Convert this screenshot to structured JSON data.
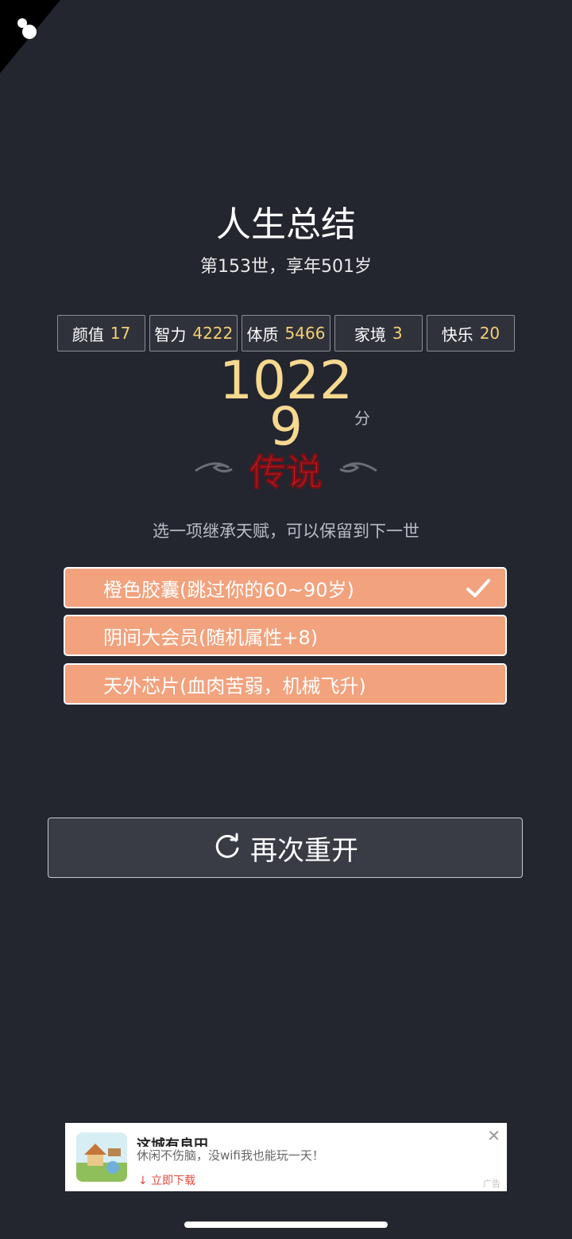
{
  "header": {
    "title": "人生总结",
    "subtitle": "第153世，享年501岁"
  },
  "stats": [
    {
      "label": "颜值",
      "value": "17"
    },
    {
      "label": "智力",
      "value": "4222"
    },
    {
      "label": "体质",
      "value": "5466"
    },
    {
      "label": "家境",
      "value": "3"
    },
    {
      "label": "快乐",
      "value": "20"
    }
  ],
  "score": {
    "value": "10229",
    "unit": "分",
    "grade": "传说"
  },
  "inherit": {
    "prompt": "选一项继承天赋，可以保留到下一世",
    "options": [
      {
        "label": "橙色胶囊(跳过你的60~90岁)",
        "selected": true
      },
      {
        "label": "阴间大会员(随机属性+8)",
        "selected": false
      },
      {
        "label": "天外芯片(血肉苦弱，机械飞升)",
        "selected": false
      }
    ]
  },
  "restart": {
    "label": "再次重开"
  },
  "ad": {
    "title": "这城有良田",
    "description": "休闲不伤脑，没wifi我也能玩一天！",
    "cta": "↓ 立即下载",
    "close": "✕",
    "tag": "广告"
  },
  "colors": {
    "background": "#23252f",
    "stat_value": "#f4cf74",
    "score": "#f6d98f",
    "talent_bg": "#f2a27d",
    "grade_red": "#c8202a"
  }
}
